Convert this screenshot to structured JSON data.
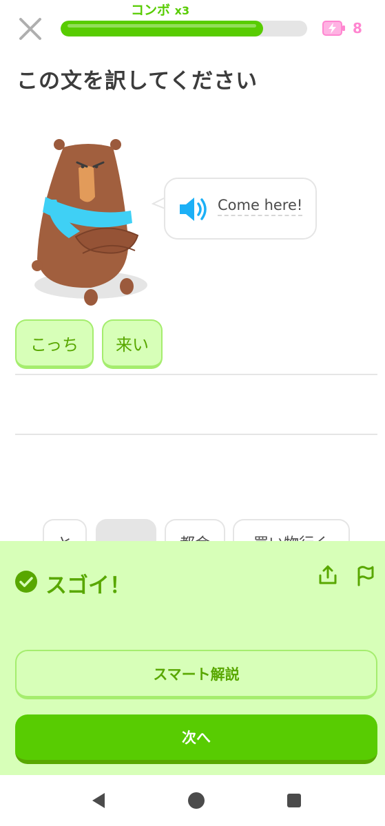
{
  "header": {
    "combo_label": "コンボ",
    "combo_multiplier": "x3",
    "progress": 0.82,
    "energy_count": "8"
  },
  "exercise": {
    "instruction": "この文を訳してください",
    "prompt": "Come here!",
    "character": "bear"
  },
  "answer_tokens": [
    "こっち",
    "来い"
  ],
  "word_bank": [
    "と",
    "",
    "都会",
    "買い物行く"
  ],
  "feedback": {
    "title": "スゴイ！",
    "explain_button": "スマート解説",
    "next_button": "次へ"
  },
  "colors": {
    "accent": "#58cc02",
    "accent_dark": "#58a700",
    "feedback_bg": "#d7ffb8",
    "chip_border": "#a5ed6e",
    "energy": "#ff86d0",
    "speaker": "#1cb0f6"
  },
  "icons": {
    "close": "close-icon",
    "energy": "battery-bolt-icon",
    "speaker": "speaker-icon",
    "check": "check-circle-icon",
    "share": "share-icon",
    "flag": "flag-icon",
    "back": "back-triangle-icon",
    "home": "home-circle-icon",
    "recents": "recents-square-icon"
  }
}
